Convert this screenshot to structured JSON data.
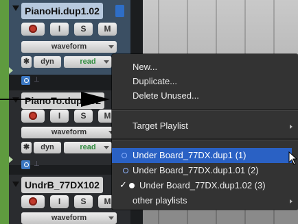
{
  "tracks": [
    {
      "name": "PianoHi.dup1.02",
      "buttons": [
        "I",
        "S",
        "M"
      ],
      "view": "waveform",
      "dyn": "dyn",
      "mode": "read",
      "selected": true
    },
    {
      "name": "PianoTo.dup1.02",
      "buttons": [
        "I",
        "S",
        "M"
      ],
      "view": "waveform",
      "dyn": "dyn",
      "mode": "read",
      "selected": false
    },
    {
      "name": "UndrB_77DX102",
      "buttons": [
        "I",
        "S",
        "M"
      ],
      "view": "waveform",
      "selected": false
    }
  ],
  "menu": {
    "items_top": [
      "New...",
      "Duplicate...",
      "Delete Unused..."
    ],
    "target": "Target Playlist",
    "playlists": [
      {
        "label": "Under Board_77DX.dup1 (1)",
        "checked": false,
        "highlighted": true
      },
      {
        "label": "Under Board_77DX.dup1.01 (2)",
        "checked": false,
        "highlighted": false
      },
      {
        "label": "Under Board_77DX.dup1.02 (3)",
        "checked": true,
        "highlighted": false
      }
    ],
    "other": "other playlists"
  },
  "colors": {
    "menu_bg": "#333333",
    "highlight": "#2a61c4",
    "track_strip": "#5f9b3f",
    "record_red": "#c0392b"
  }
}
